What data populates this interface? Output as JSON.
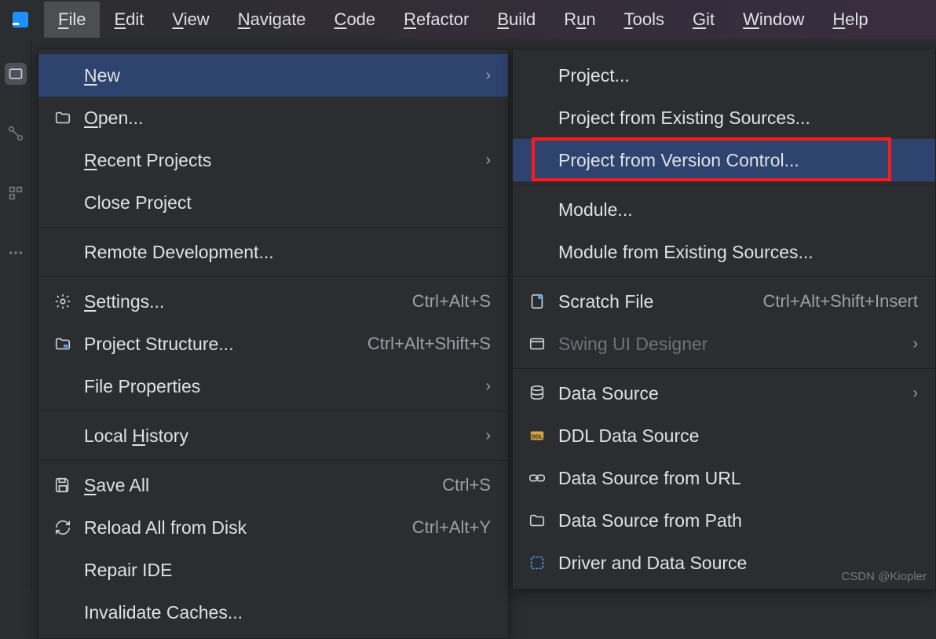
{
  "menubar": {
    "items": [
      {
        "label": "File",
        "mnemonic": 0,
        "active": true
      },
      {
        "label": "Edit",
        "mnemonic": 0
      },
      {
        "label": "View",
        "mnemonic": 0
      },
      {
        "label": "Navigate",
        "mnemonic": 0
      },
      {
        "label": "Code",
        "mnemonic": 0
      },
      {
        "label": "Refactor",
        "mnemonic": 0
      },
      {
        "label": "Build",
        "mnemonic": 0
      },
      {
        "label": "Run",
        "mnemonic": 1
      },
      {
        "label": "Tools",
        "mnemonic": 0
      },
      {
        "label": "Git",
        "mnemonic": 0
      },
      {
        "label": "Window",
        "mnemonic": 0
      },
      {
        "label": "Help",
        "mnemonic": 0
      }
    ]
  },
  "fileMenu": {
    "items": [
      {
        "icon": null,
        "label": "New",
        "mnemonic": 0,
        "submenu": true,
        "highlighted": true
      },
      {
        "icon": "folder",
        "label": "Open...",
        "mnemonic": 0
      },
      {
        "icon": null,
        "label": "Recent Projects",
        "mnemonic": 0,
        "submenu": true
      },
      {
        "icon": null,
        "label": "Close Project"
      },
      {
        "sep": true
      },
      {
        "icon": null,
        "label": "Remote Development..."
      },
      {
        "sep": true
      },
      {
        "icon": "gear",
        "label": "Settings...",
        "mnemonic": 0,
        "shortcut": "Ctrl+Alt+S"
      },
      {
        "icon": "project-structure",
        "label": "Project Structure...",
        "shortcut": "Ctrl+Alt+Shift+S"
      },
      {
        "icon": null,
        "label": "File Properties",
        "submenu": true
      },
      {
        "sep": true
      },
      {
        "icon": null,
        "label": "Local History",
        "mnemonic": 6,
        "submenu": true
      },
      {
        "sep": true
      },
      {
        "icon": "save",
        "label": "Save All",
        "mnemonic": 0,
        "shortcut": "Ctrl+S"
      },
      {
        "icon": "reload",
        "label": "Reload All from Disk",
        "shortcut": "Ctrl+Alt+Y"
      },
      {
        "icon": null,
        "label": "Repair IDE"
      },
      {
        "icon": null,
        "label": "Invalidate Caches..."
      }
    ]
  },
  "newMenu": {
    "items": [
      {
        "icon": null,
        "label": "Project..."
      },
      {
        "icon": null,
        "label": "Project from Existing Sources..."
      },
      {
        "icon": null,
        "label": "Project from Version Control...",
        "highlighted": true,
        "boxed": true
      },
      {
        "sep": true
      },
      {
        "icon": null,
        "label": "Module..."
      },
      {
        "icon": null,
        "label": "Module from Existing Sources..."
      },
      {
        "sep": true
      },
      {
        "icon": "scratch",
        "label": "Scratch File",
        "shortcut": "Ctrl+Alt+Shift+Insert"
      },
      {
        "icon": "window",
        "label": "Swing UI Designer",
        "submenu": true,
        "disabled": true
      },
      {
        "sep": true
      },
      {
        "icon": "database",
        "label": "Data Source",
        "submenu": true
      },
      {
        "icon": "ddl",
        "label": "DDL Data Source"
      },
      {
        "icon": "url",
        "label": "Data Source from URL"
      },
      {
        "icon": "folder",
        "label": "Data Source from Path"
      },
      {
        "icon": "driver",
        "label": "Driver and Data Source"
      }
    ]
  },
  "watermark": "CSDN @Kiopler"
}
